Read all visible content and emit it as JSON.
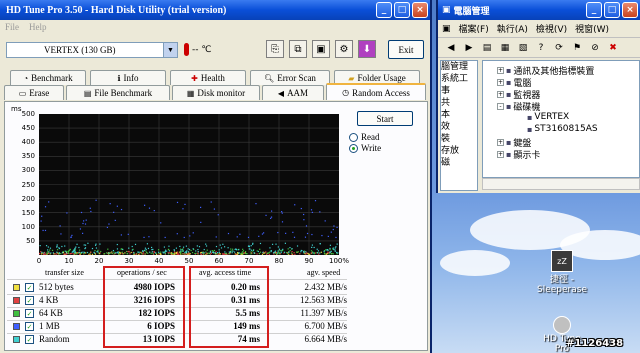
{
  "hdtune": {
    "title": "HD Tune Pro 3.50 - Hard Disk Utility (trial version)",
    "titlebar_buttons": [
      "_",
      "□",
      "×"
    ],
    "menu": [
      "File",
      "Help"
    ],
    "drive": "VERTEX (130 GB)",
    "temperature": "-- ℃",
    "exit_label": "Exit",
    "tabs_row1": [
      "Benchmark",
      "Info",
      "Health",
      "Error Scan",
      "Folder Usage"
    ],
    "tabs_row2": [
      "Erase",
      "File Benchmark",
      "Disk monitor",
      "AAM",
      "Random Access"
    ],
    "active_tab": "Random Access",
    "start_label": "Start",
    "read_label": "Read",
    "write_label": "Write",
    "selected_mode": "Write"
  },
  "chart_data": {
    "type": "scatter",
    "ylabel": "ms",
    "xlabel": "",
    "xlim": [
      0,
      100
    ],
    "ylim": [
      0,
      500
    ],
    "x_ticks": [
      "0",
      "10",
      "20",
      "30",
      "40",
      "50",
      "60",
      "70",
      "80",
      "90",
      "100%"
    ],
    "y_ticks": [
      "500",
      "450",
      "400",
      "350",
      "300",
      "250",
      "200",
      "150",
      "100",
      "50"
    ],
    "grid": true,
    "series": [
      {
        "name": "512 bytes",
        "color": "#f0e040",
        "y_range": [
          0,
          8
        ]
      },
      {
        "name": "4 KB",
        "color": "#e04040",
        "y_range": [
          0,
          10
        ]
      },
      {
        "name": "64 KB",
        "color": "#40c040",
        "y_range": [
          2,
          20
        ]
      },
      {
        "name": "1 MB",
        "color": "#4060ff",
        "y_range": [
          60,
          200
        ]
      },
      {
        "name": "Random",
        "color": "#40d0d0",
        "y_range": [
          5,
          40
        ]
      }
    ]
  },
  "results": {
    "headers": {
      "transfer_size": "transfer size",
      "operations": "operations / sec",
      "access_time": "avg. access time",
      "speed": "agv. speed"
    },
    "rows": [
      {
        "label": "512 bytes",
        "color": "#f0e040",
        "ops": "4980 IOPS",
        "access": "0.20 ms",
        "speed": "2.432 MB/s"
      },
      {
        "label": "4 KB",
        "color": "#e04040",
        "ops": "3216 IOPS",
        "access": "0.31 ms",
        "speed": "12.563 MB/s"
      },
      {
        "label": "64 KB",
        "color": "#40c040",
        "ops": "182 IOPS",
        "access": "5.5 ms",
        "speed": "11.397 MB/s"
      },
      {
        "label": "1 MB",
        "color": "#4060ff",
        "ops": "6 IOPS",
        "access": "149 ms",
        "speed": "6.700 MB/s"
      },
      {
        "label": "Random",
        "color": "#40d0d0",
        "ops": "13 IOPS",
        "access": "74 ms",
        "speed": "6.664 MB/s"
      }
    ]
  },
  "compmgmt": {
    "title": "電腦管理",
    "titlebar_buttons": [
      "_",
      "□",
      "×"
    ],
    "menu": [
      "檔案(F)",
      "執行(A)",
      "檢視(V)",
      "視窗(W)"
    ],
    "left_items": [
      "腦管理",
      "系統工",
      "事",
      "共",
      "本",
      "效",
      "裝",
      "存放",
      "磁"
    ],
    "tree": [
      {
        "label": "通訊及其他指標裝置",
        "expander": "+"
      },
      {
        "label": "電腦",
        "expander": "+"
      },
      {
        "label": "監視器",
        "expander": "+"
      },
      {
        "label": "磁碟機",
        "expander": "-"
      },
      {
        "label": "VERTEX",
        "expander": ""
      },
      {
        "label": "ST3160815AS",
        "expander": ""
      },
      {
        "label": "鍵盤",
        "expander": "+"
      },
      {
        "label": "顯示卡",
        "expander": "+"
      }
    ]
  },
  "desktop": {
    "icons": [
      {
        "label": "捷徑 - Sleeperase"
      },
      {
        "label": "HD Tune Pro"
      }
    ],
    "watermark": "#1126438"
  },
  "colors": {
    "titlebar": "#0a4fd8",
    "plot_bg": "#0a0a0a",
    "highlight": "#d41e1e"
  }
}
